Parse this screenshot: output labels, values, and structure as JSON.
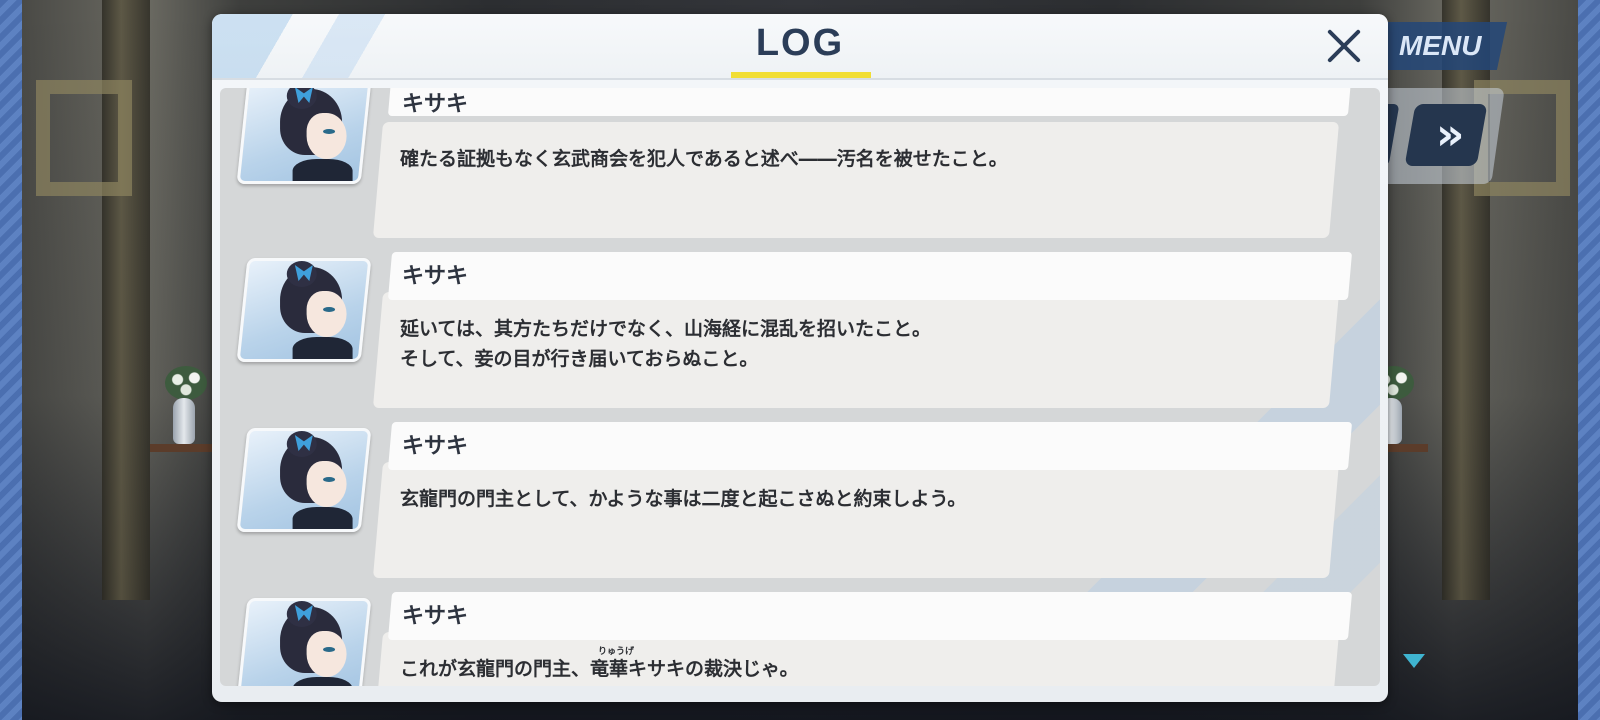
{
  "hud": {
    "menu_label": "MENU",
    "fast_forward_glyph": "»",
    "scroll_indicator_color": "#3fb4d0"
  },
  "log": {
    "title": "LOG",
    "accent_color": "#f1de35",
    "entries": [
      {
        "speaker": "キサキ",
        "text": "確たる証拠もなく玄武商会を犯人であると述べ――汚名を被せたこと。"
      },
      {
        "speaker": "キサキ",
        "text": "延いては、其方たちだけでなく、山海経に混乱を招いたこと。\nそして、妾の目が行き届いておらぬこと。"
      },
      {
        "speaker": "キサキ",
        "text": "玄龍門の門主として、かような事は二度と起こさぬと約束しよう。"
      },
      {
        "speaker": "キサキ",
        "text": "これが玄龍門の門主、竜華キサキの裁決じゃ。",
        "ruby": "りゅうげ"
      }
    ]
  }
}
